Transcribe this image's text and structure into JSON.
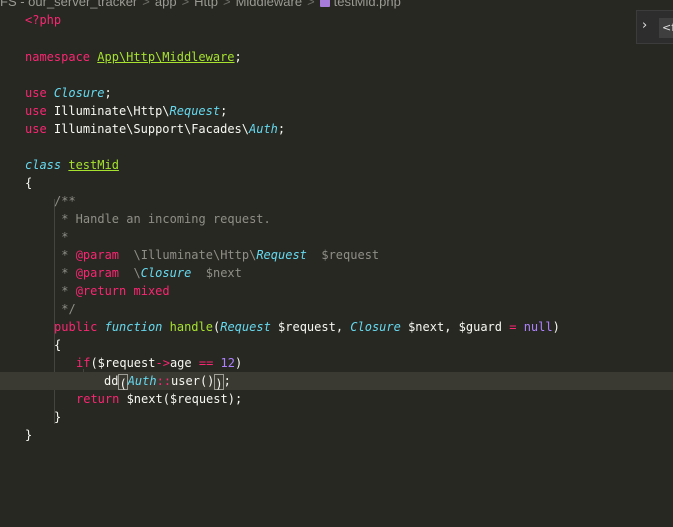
{
  "breadcrumb": {
    "project": "FS - our_server_tracker",
    "path1": "app",
    "path2": "Http",
    "path3": "Middleware",
    "file": "testMid.php",
    "separator": ">"
  },
  "panel": {
    "chevron": "›",
    "tab_text": "<f"
  },
  "code": {
    "l1_open": "<?php",
    "l3_kw": "namespace",
    "l3_ns": "App\\Http\\Middleware",
    "semicolon": ";",
    "use_kw": "use",
    "l5_class": "Closure",
    "l6_ns": "Illuminate\\Http\\",
    "l6_class": "Request",
    "l7_ns": "Illuminate\\Support\\Facades\\",
    "l7_class": "Auth",
    "class_kw": "class",
    "class_name": "testMid",
    "brace_open": "{",
    "brace_close": "}",
    "doc_open": "/**",
    "doc_desc": " * Handle an incoming request.",
    "doc_star": " *",
    "doc_star_prefix": " * ",
    "doc_param_tag": "@param",
    "doc_p1_ns": "  \\Illuminate\\Http\\",
    "doc_p1_class": "Request",
    "doc_p1_var": "  $request",
    "doc_p2_slash": "  \\",
    "doc_p2_class": "Closure",
    "doc_p2_var": "  $next",
    "doc_return_tag": "@return",
    "doc_return_type": " mixed",
    "doc_close": " */",
    "public_kw": "public",
    "function_kw": "function",
    "method_name": "handle",
    "paren_open": "(",
    "paren_close": ")",
    "param_type1": "Request",
    "param_var1": " $request, ",
    "param_type2": "Closure",
    "param_var2": " $next, $guard ",
    "eq": "=",
    "null_kw": "null",
    "if_kw": "if",
    "if_var": "($request",
    "arrow": "->",
    "if_prop": "age ",
    "eqeq": "==",
    "if_num": "12",
    "dd_fn": "dd",
    "auth_class": "Auth",
    "dcolon": "::",
    "user_fn": "user",
    "paren_empty": "()",
    "dd_tail": ");",
    "return_kw": "return",
    "return_rest": " $next($request);"
  }
}
